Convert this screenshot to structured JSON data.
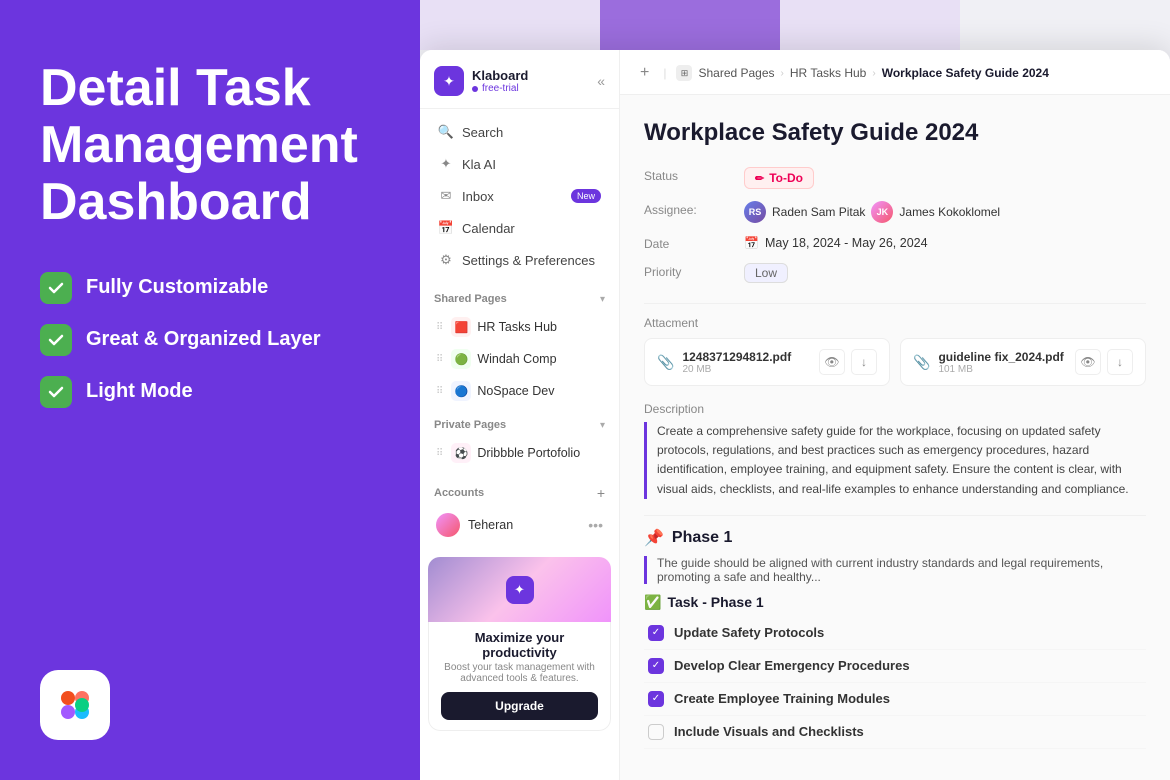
{
  "hero": {
    "title": "Detail Task Management Dashboard",
    "features": [
      {
        "text": "Fully Customizable"
      },
      {
        "text": "Great & Organized Layer"
      },
      {
        "text": "Light Mode"
      }
    ]
  },
  "sidebar": {
    "brand": {
      "name": "Klaboard",
      "badge": "free-trial"
    },
    "nav": [
      {
        "icon": "🔍",
        "label": "Search"
      },
      {
        "icon": "✦",
        "label": "Kla AI"
      },
      {
        "icon": "✉",
        "label": "Inbox",
        "badge": "New"
      },
      {
        "icon": "📅",
        "label": "Calendar"
      },
      {
        "icon": "⚙",
        "label": "Settings & Preferences"
      }
    ],
    "shared_pages": {
      "title": "Shared Pages",
      "items": [
        {
          "icon": "🟥",
          "label": "HR Tasks Hub",
          "color": "#ff5c5c"
        },
        {
          "icon": "🟢",
          "label": "Windah Comp",
          "color": "#4CAF50"
        },
        {
          "icon": "🔵",
          "label": "NoSpace Dev",
          "color": "#2196F3"
        }
      ]
    },
    "private_pages": {
      "title": "Private Pages",
      "items": [
        {
          "icon": "⚽",
          "label": "Dribbble Portofolio",
          "color": "#E91E8C"
        }
      ]
    },
    "accounts": {
      "title": "Accounts",
      "items": [
        {
          "name": "Teheran"
        }
      ]
    },
    "upgrade": {
      "title": "Maximize your productivity",
      "subtitle": "Boost your task management with advanced tools & features.",
      "button": "Upgrade"
    }
  },
  "breadcrumb": {
    "add_label": "+",
    "shared_pages": "Shared Pages",
    "hub": "HR Tasks Hub",
    "current": "Workplace Safety Guide 2024"
  },
  "task": {
    "title": "Workplace Safety Guide 2024",
    "status": "To-Do",
    "assignees": [
      {
        "name": "Raden Sam Pitak",
        "initials": "RS"
      },
      {
        "name": "James Kokoklomel",
        "initials": "JK"
      }
    ],
    "date": "May 18, 2024 - May 26, 2024",
    "priority": "Low",
    "attachment_label": "Attacment",
    "attachments": [
      {
        "name": "1248371294812.pdf",
        "size": "20 MB"
      },
      {
        "name": "guideline fix_2024.pdf",
        "size": "101 MB"
      }
    ],
    "description_label": "Description",
    "description": "Create a comprehensive safety guide for the workplace, focusing on updated safety protocols, regulations, and best practices such as emergency procedures, hazard identification, employee training, and equipment safety. Ensure the content is clear, with visual aids, checklists, and real-life examples to enhance understanding and compliance.",
    "phase": {
      "title": "Phase 1",
      "emoji": "📌",
      "description": "The guide should be aligned with current industry standards and legal requirements, promoting a safe and healthy...",
      "task_group": {
        "title": "Task - Phase 1",
        "emoji": "✅",
        "tasks": [
          {
            "text": "Update Safety Protocols",
            "checked": true
          },
          {
            "text": "Develop Clear Emergency Procedures",
            "checked": true
          },
          {
            "text": "Create Employee Training Modules",
            "checked": true
          },
          {
            "text": "Include Visuals and Checklists",
            "checked": false
          }
        ]
      }
    }
  }
}
